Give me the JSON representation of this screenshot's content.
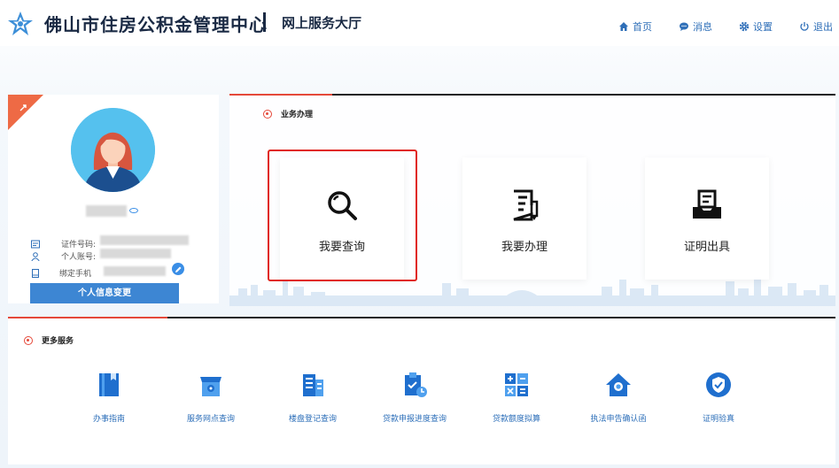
{
  "header": {
    "title": "佛山市住房公积金管理中心",
    "subtitle": "网上服务大厅",
    "nav": [
      {
        "label": "首页",
        "icon": "home-icon"
      },
      {
        "label": "消息",
        "icon": "message-icon"
      },
      {
        "label": "设置",
        "icon": "settings-icon"
      },
      {
        "label": "退出",
        "icon": "logout-icon"
      }
    ]
  },
  "profile": {
    "id_label": "证件号码:",
    "account_label": "个人账号:",
    "phone_label": "绑定手机",
    "button_label": "个人信息变更"
  },
  "business": {
    "section_title": "业务办理",
    "cards": [
      {
        "label": "我要查询",
        "icon": "search-icon"
      },
      {
        "label": "我要办理",
        "icon": "document-edit-icon"
      },
      {
        "label": "证明出具",
        "icon": "certificate-tray-icon"
      }
    ]
  },
  "more": {
    "section_title": "更多服务",
    "items": [
      {
        "label": "办事指南",
        "icon": "guide-book-icon"
      },
      {
        "label": "服务网点查询",
        "icon": "service-outlet-icon"
      },
      {
        "label": "楼盘登记查询",
        "icon": "building-icon"
      },
      {
        "label": "贷款申报进度查询",
        "icon": "loan-progress-icon"
      },
      {
        "label": "贷款额度拟算",
        "icon": "calculator-icon"
      },
      {
        "label": "执法申告确认函",
        "icon": "house-search-icon"
      },
      {
        "label": "证明验真",
        "icon": "shield-check-icon"
      }
    ]
  },
  "colors": {
    "accent": "#3d86d3",
    "link": "#2d6fb9",
    "red": "#e5493a",
    "highlight": "#e0231a"
  }
}
